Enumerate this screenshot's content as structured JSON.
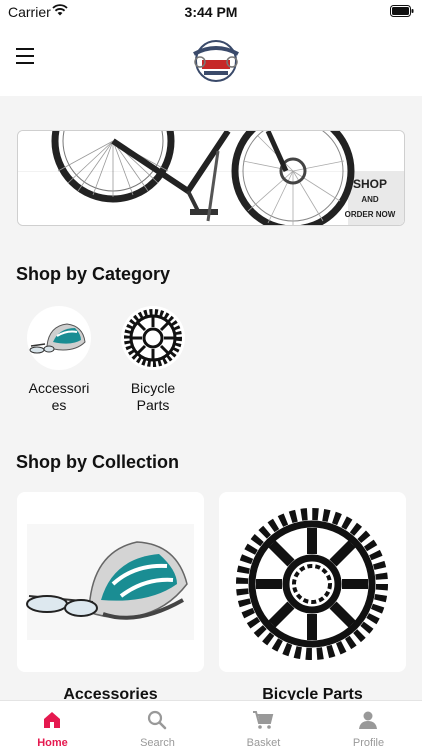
{
  "status_bar": {
    "carrier": "Carrier",
    "time": "3:44 PM"
  },
  "header": {
    "logo_icon": "bike-shop-logo"
  },
  "banner": {
    "line1": "SHOP",
    "line2": "AND",
    "line3": "ORDER NOW"
  },
  "categories": {
    "title": "Shop by Category",
    "items": [
      {
        "label": "Accessories",
        "icon": "helmet"
      },
      {
        "label": "Bicycle Parts",
        "icon": "chainring"
      }
    ]
  },
  "collections": {
    "title": "Shop by Collection",
    "items": [
      {
        "label": "Accessories",
        "icon": "helmet"
      },
      {
        "label": "Bicycle Parts",
        "icon": "chainring"
      }
    ]
  },
  "tabs": [
    {
      "label": "Home",
      "icon": "home-icon",
      "active": true
    },
    {
      "label": "Search",
      "icon": "search-icon"
    },
    {
      "label": "Basket",
      "icon": "cart-icon"
    },
    {
      "label": "Profile",
      "icon": "person-icon"
    }
  ],
  "colors": {
    "accent": "#e5194f",
    "inactive": "#999999",
    "background": "#f4f4f4"
  }
}
